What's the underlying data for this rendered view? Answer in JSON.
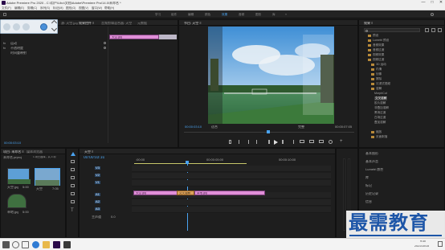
{
  "window": {
    "title": "Adobe Premiere Pro 2020 - C:\\用户\\Libo\\文档\\Adobe\\Premiere Pro\\14.0\\未命名 *",
    "minimize": "—",
    "maximize": "□",
    "close": "✕"
  },
  "menu": [
    "文件(F)",
    "编辑(E)",
    "剪辑(C)",
    "序列(S)",
    "标记(M)",
    "图形(G)",
    "视图(V)",
    "窗口(W)",
    "帮助(H)"
  ],
  "workspaces": [
    "学习",
    "组件",
    "编辑",
    "颜色",
    "效果",
    "音频",
    "图形",
    "库",
    "»"
  ],
  "workspace_active": "效果",
  "source_panel": {
    "tabs": [
      "源: 天空.jpg",
      "效果控件 ≡",
      "音频剪辑混合器: 天空",
      "元数据"
    ],
    "clip_name": "天空.jpg",
    "items": [
      "运动",
      "不透明度",
      "时间重映射"
    ],
    "sub_items": [
      "fx",
      "fx",
      ""
    ],
    "timecode": "00:00:03:10"
  },
  "program_monitor": {
    "title": "节目: 天空 ≡",
    "timecode_left": "00:00:03:10",
    "fit": "适合",
    "quality": "完整",
    "timecode_right": "00:00:07:05"
  },
  "effects_panel": {
    "title": "效果 ≡",
    "items": [
      "预设",
      "Lumetri 预设",
      "音频效果",
      "音频过渡",
      "视频效果",
      "视频过渡",
      "3D 运动",
      "内滑",
      "划像",
      "擦除",
      "沉浸式视频",
      "溶解",
      "MorphCut",
      "交叉溶解",
      "胶片溶解",
      "非叠加溶解",
      "黑场过渡",
      "白场过渡",
      "叠加溶解",
      "缩放",
      "页面剥落"
    ],
    "bottom_items": [
      "基本图形",
      "基本声音",
      "Lumetri 颜色",
      "库",
      "标记",
      "历史记录",
      "信息"
    ]
  },
  "project_panel": {
    "tabs": [
      "项目: 未命名 ≡",
      "媒体浏览器"
    ],
    "filename": "未命名.prproj",
    "count": "1 项已选择，共 3 项",
    "items": [
      {
        "name": "天空.jpg",
        "duration": "5:00"
      },
      {
        "name": "天空",
        "duration": "7:05"
      },
      {
        "name": "草地.jpg",
        "duration": "5:00"
      }
    ]
  },
  "timeline": {
    "tab": "天空 ≡",
    "timecode": "00:00:03:10",
    "ruler": [
      ":00:00",
      "00:00:05:00",
      "00:00:10:00"
    ],
    "tracks_v": [
      "V3",
      "V2",
      "V1"
    ],
    "tracks_a": [
      "A1",
      "A2",
      "A3"
    ],
    "master": "主声道",
    "master_value": "0.0",
    "clips": [
      {
        "label": "天空.jpg",
        "track": "V1"
      },
      {
        "label": "交叉溶解",
        "track": "V1"
      },
      {
        "label": "草地.jpg",
        "track": "V1"
      }
    ]
  },
  "taskbar": {
    "time": "9:30",
    "date": "2021/10/15"
  },
  "watermark": {
    "text": "最需教育"
  },
  "colors": {
    "accent_blue": "#4aa3f0",
    "clip_pink": "#e08fd8",
    "transition_orange": "#d9a05b"
  }
}
